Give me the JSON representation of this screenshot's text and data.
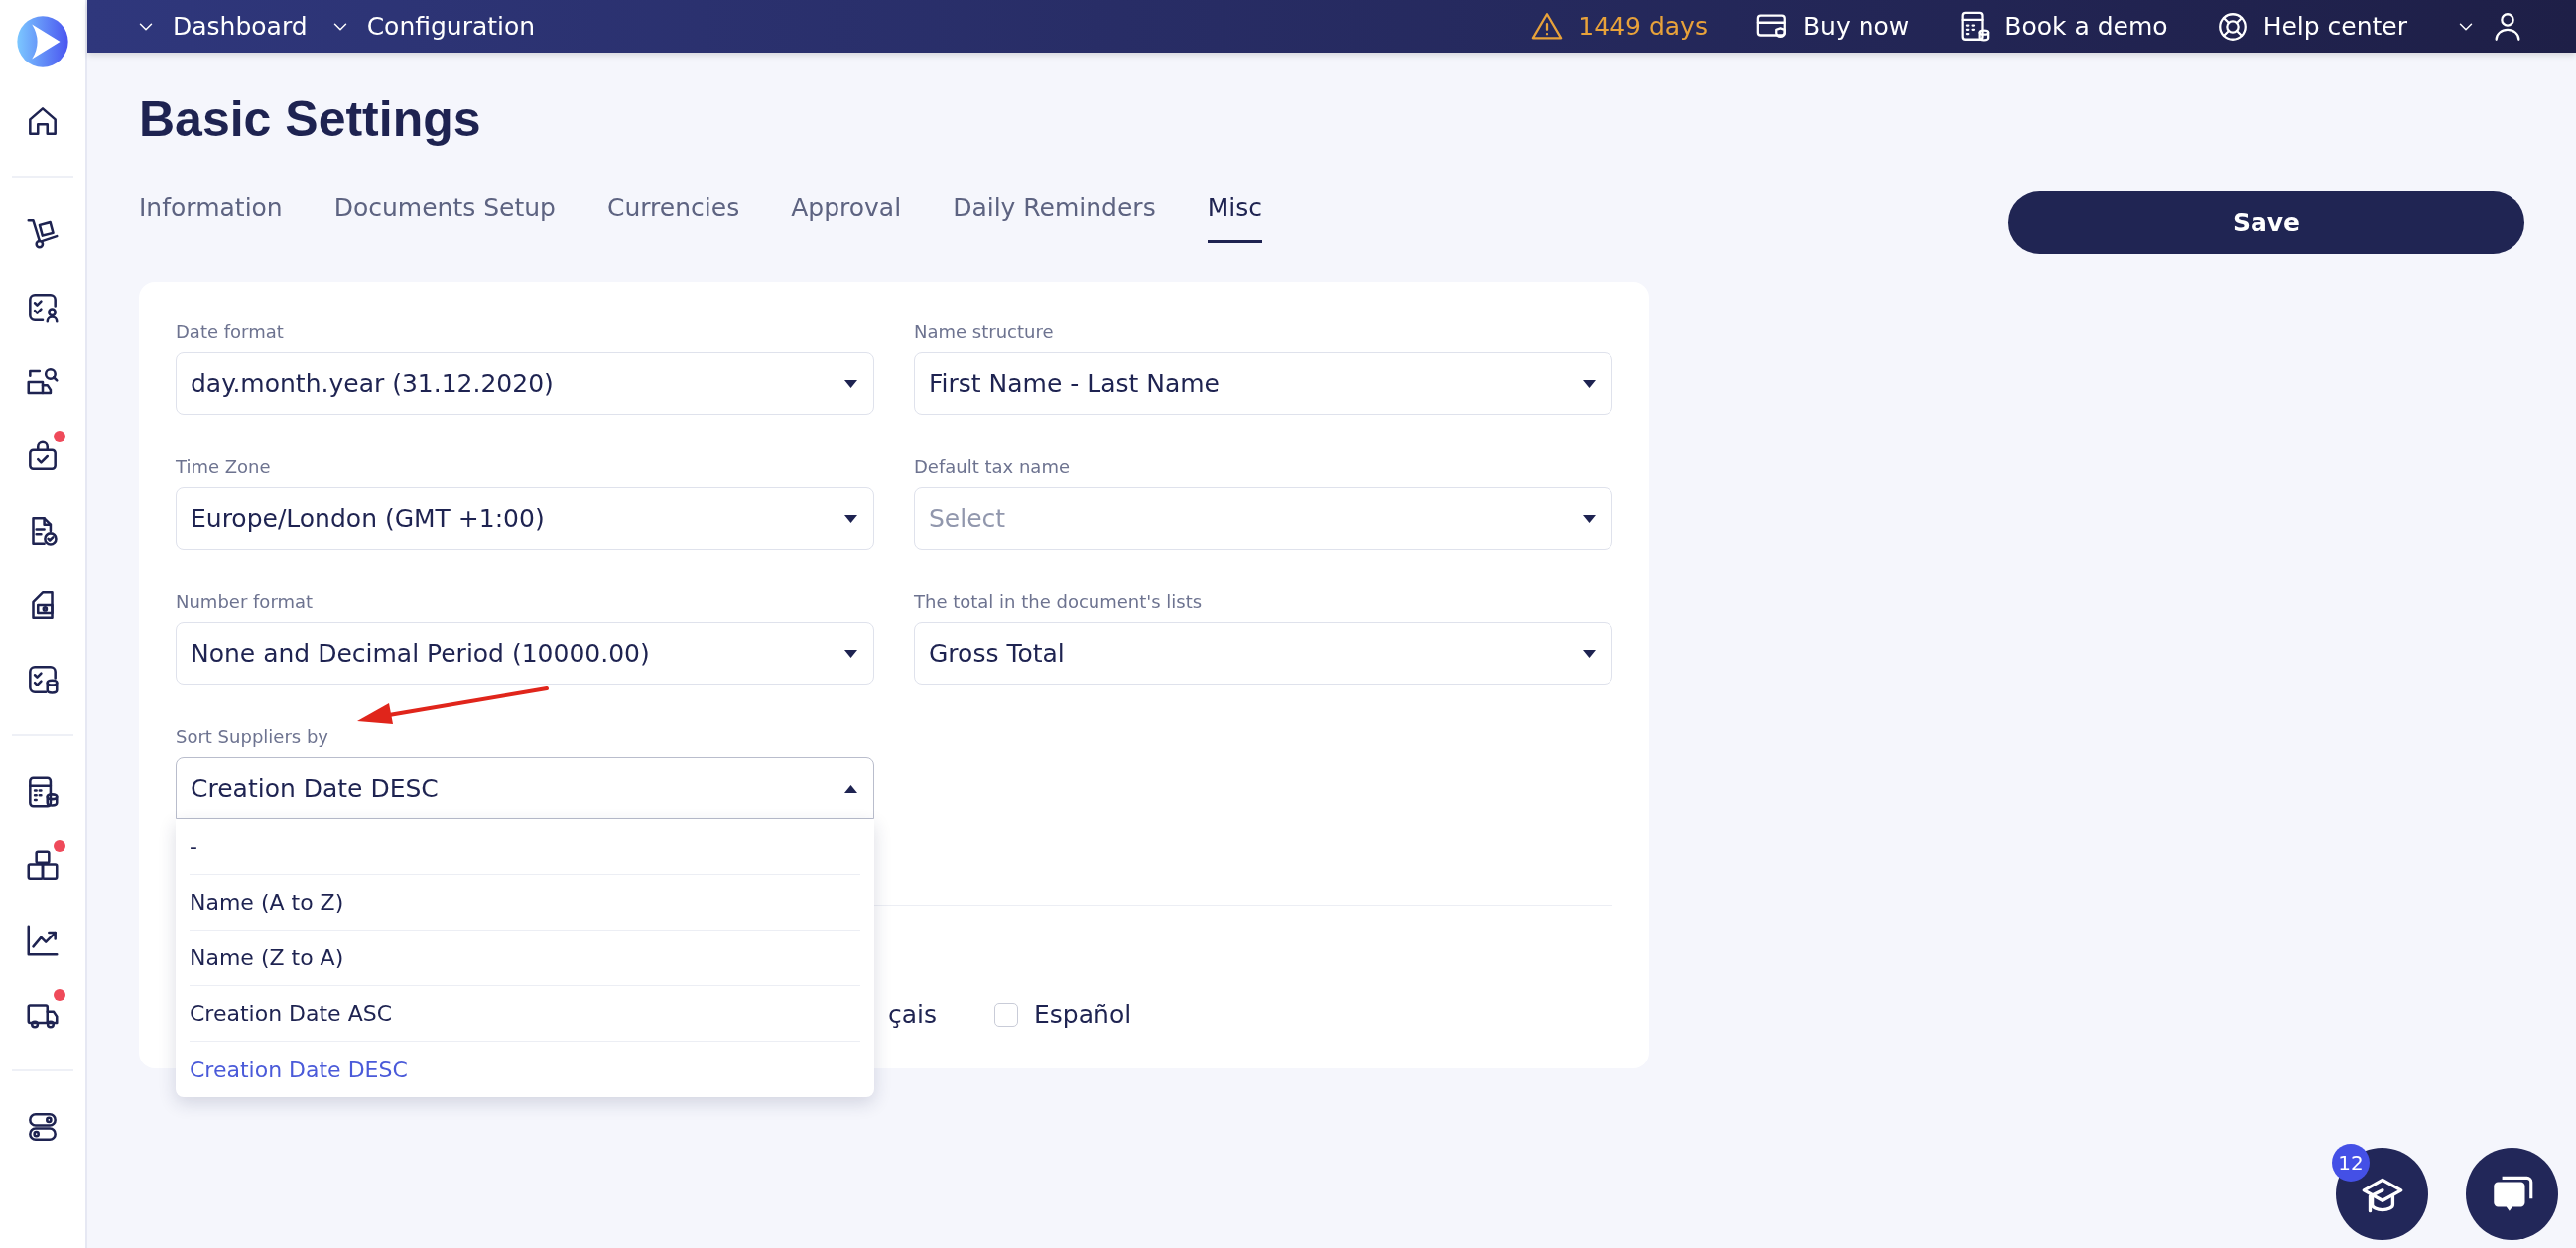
{
  "topbar": {
    "breadcrumbs": [
      "Dashboard",
      "Configuration"
    ],
    "trial": "1449 days",
    "links": [
      "Buy now",
      "Book a demo",
      "Help center"
    ]
  },
  "sidebar": {
    "items": [
      {
        "alert": false
      },
      {
        "alert": false
      },
      {
        "alert": false
      },
      {
        "alert": false
      },
      {
        "alert": true
      },
      {
        "alert": false
      },
      {
        "alert": false
      },
      {
        "alert": false
      },
      {
        "alert": false
      },
      {
        "alert": true
      },
      {
        "alert": false
      },
      {
        "alert": true
      },
      {
        "alert": false
      }
    ]
  },
  "page": {
    "title": "Basic Settings",
    "save": "Save"
  },
  "tabs": [
    {
      "label": "Information",
      "selected": false
    },
    {
      "label": "Documents Setup",
      "selected": false
    },
    {
      "label": "Currencies",
      "selected": false
    },
    {
      "label": "Approval",
      "selected": false
    },
    {
      "label": "Daily Reminders",
      "selected": false
    },
    {
      "label": "Misc",
      "selected": true
    }
  ],
  "fields": [
    {
      "label": "Date format",
      "value": "day.month.year (31.12.2020)",
      "open": false
    },
    {
      "label": "Name structure",
      "value": "First Name - Last Name",
      "open": false
    },
    {
      "label": "Time Zone",
      "value": "Europe/London (GMT +1:00)",
      "open": false
    },
    {
      "label": "Default tax name",
      "placeholder": "Select",
      "open": false
    },
    {
      "label": "Number format",
      "value": "None and Decimal Period (10000.00)",
      "open": false
    },
    {
      "label": "The total in the document's lists",
      "value": "Gross Total",
      "open": false
    },
    {
      "label": "Sort Suppliers by",
      "value": "Creation Date DESC",
      "open": true,
      "options": [
        {
          "label": "-",
          "selected": false
        },
        {
          "label": "Name (A to Z)",
          "selected": false
        },
        {
          "label": "Name (Z to A)",
          "selected": false
        },
        {
          "label": "Creation Date ASC",
          "selected": false
        },
        {
          "label": "Creation Date DESC",
          "selected": true
        }
      ]
    }
  ],
  "languages": [
    {
      "kind": "partial",
      "label": "çais"
    },
    {
      "kind": "checkbox",
      "label": "Español",
      "checked": false
    }
  ],
  "help": {
    "badge": "12"
  }
}
